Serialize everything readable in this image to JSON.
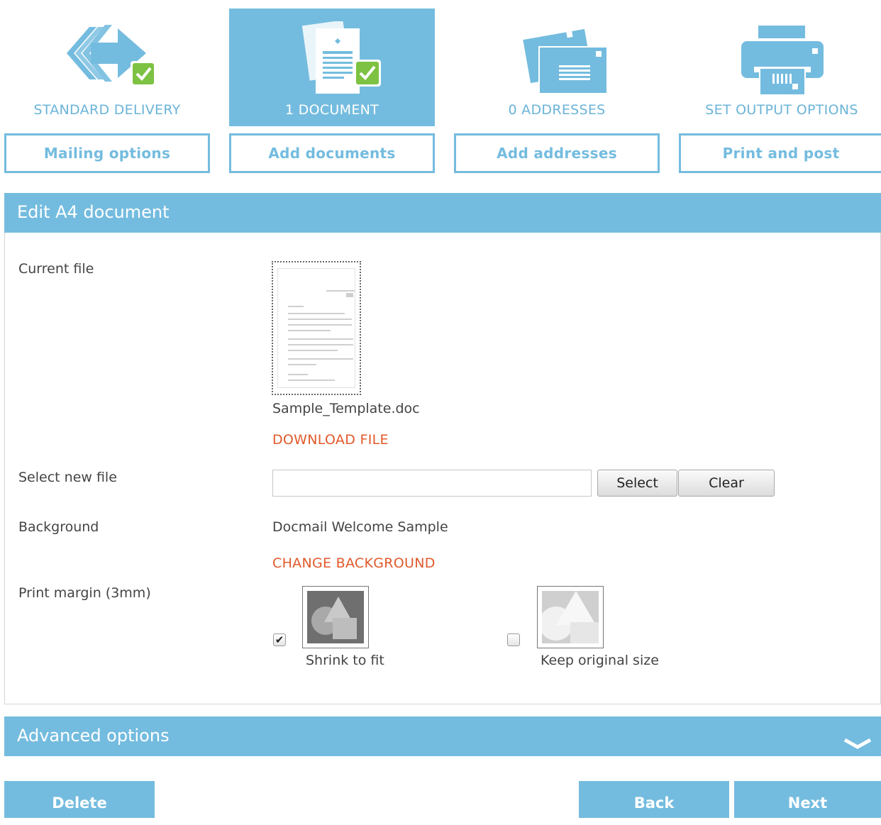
{
  "steps": [
    {
      "label": "STANDARD DELIVERY",
      "button": "Mailing options",
      "icon": "delivery-arrow-icon"
    },
    {
      "label": "1 DOCUMENT",
      "button": "Add documents",
      "icon": "document-icon"
    },
    {
      "label": "0 ADDRESSES",
      "button": "Add addresses",
      "icon": "envelopes-icon"
    },
    {
      "label": "SET OUTPUT OPTIONS",
      "button": "Print and post",
      "icon": "printer-icon"
    }
  ],
  "editor": {
    "title": "Edit A4 document",
    "current_file_label": "Current file",
    "file_name": "Sample_Template.doc",
    "download_link": "DOWNLOAD FILE",
    "select_new_file_label": "Select new file",
    "file_input_value": "",
    "select_button": "Select",
    "clear_button": "Clear",
    "background_label": "Background",
    "background_value": "Docmail Welcome Sample",
    "change_background_link": "CHANGE BACKGROUND",
    "print_margin_label": "Print margin (3mm)",
    "options": [
      {
        "label": "Shrink to fit",
        "checked": true
      },
      {
        "label": "Keep original size",
        "checked": false
      }
    ]
  },
  "advanced": {
    "title": "Advanced options"
  },
  "footer": {
    "delete": "Delete",
    "back": "Back",
    "next": "Next"
  },
  "colors": {
    "accent": "#74bcdf",
    "link": "#e05a2b",
    "check_green": "#7dc242"
  }
}
